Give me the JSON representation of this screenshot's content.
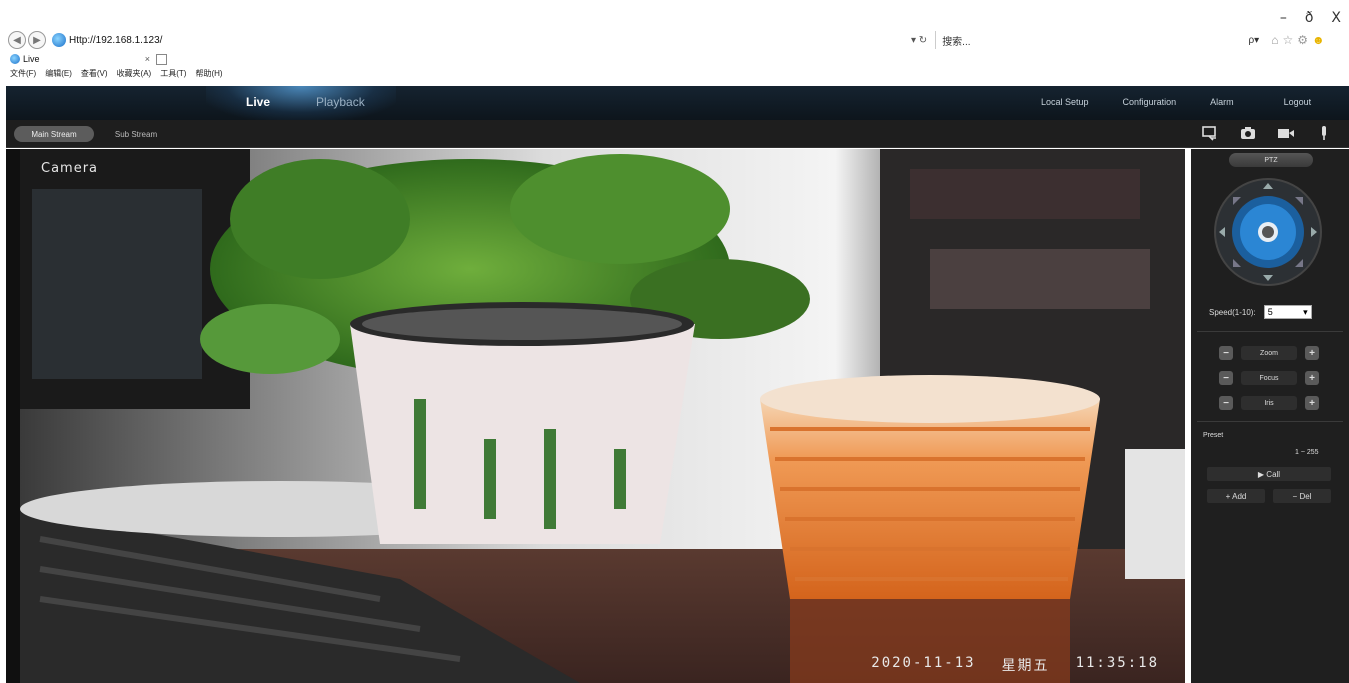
{
  "browser": {
    "window_controls": [
      "–",
      "ð",
      "X"
    ],
    "url": "Http://192.168.1.123/",
    "url_tools": "▾ ↻",
    "search_placeholder": "搜索...",
    "search_icon": "ρ▾",
    "tab_title": "Live",
    "tab_close": "×",
    "menu": [
      "文件(F)",
      "编辑(E)",
      "查看(V)",
      "收藏夹(A)",
      "工具(T)",
      "帮助(H)"
    ]
  },
  "header": {
    "nav_left": {
      "live": "Live",
      "playback": "Playback"
    },
    "nav_right": [
      "Local Setup",
      "Configuration",
      "Alarm",
      "Logout"
    ]
  },
  "stream": {
    "main": "Main Stream",
    "sub": "Sub Stream",
    "tool_icons": [
      "record-icon",
      "snapshot-icon",
      "video-record-icon",
      "microphone-icon"
    ]
  },
  "video": {
    "camera_name": "Camera",
    "osd_date": "2020-11-13",
    "osd_weekday": "星期五",
    "osd_time": "11:35:18"
  },
  "ptz": {
    "title": "PTZ",
    "speed_label": "Speed(1-10):",
    "speed_value": "5",
    "controls": [
      {
        "label": "Zoom",
        "minus": "−",
        "plus": "+"
      },
      {
        "label": "Focus",
        "minus": "−",
        "plus": "+"
      },
      {
        "label": "Iris",
        "minus": "−",
        "plus": "+"
      }
    ],
    "preset_title": "Preset",
    "preset_range": "1 ~ 255",
    "call_label": "▶ Call",
    "add_label": "+ Add",
    "del_label": "− Del"
  }
}
